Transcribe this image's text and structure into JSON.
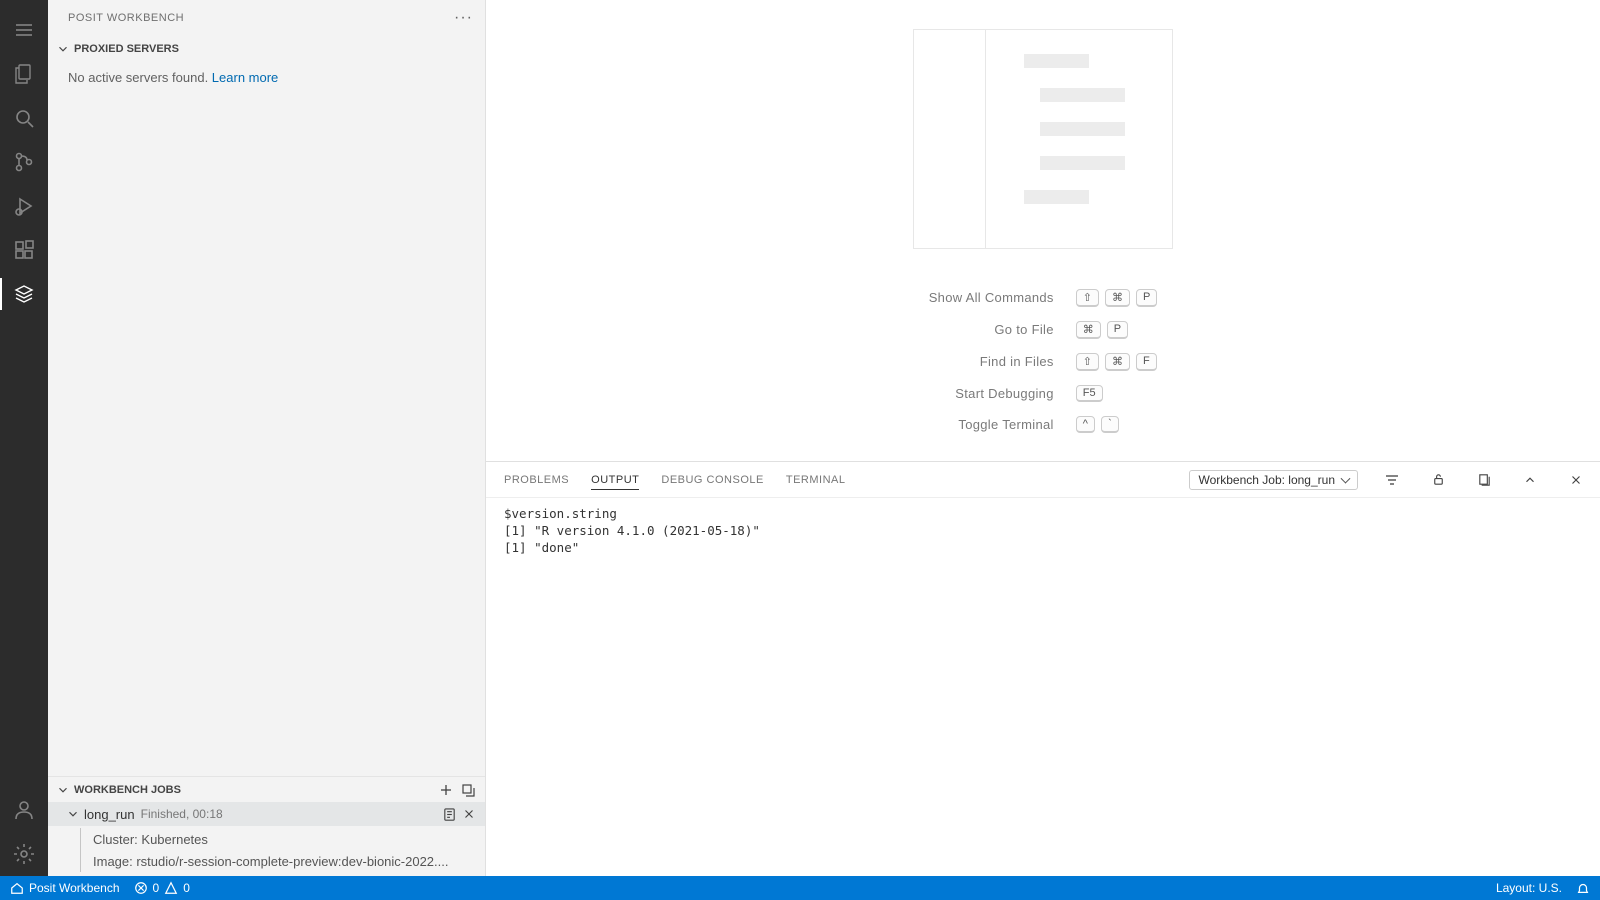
{
  "sidebar": {
    "title": "POSIT WORKBENCH",
    "proxied_section": {
      "title": "PROXIED SERVERS",
      "message": "No active servers found. ",
      "learn_more": "Learn more"
    },
    "jobs_section": {
      "title": "WORKBENCH JOBS",
      "job": {
        "name": "long_run",
        "status": "Finished, 00:18",
        "cluster": "Cluster: Kubernetes",
        "image": "Image: rstudio/r-session-complete-preview:dev-bionic-2022...."
      }
    }
  },
  "welcome": {
    "cmds": [
      {
        "label": "Show All Commands",
        "keys": [
          "⇧",
          "⌘",
          "P"
        ]
      },
      {
        "label": "Go to File",
        "keys": [
          "⌘",
          "P"
        ]
      },
      {
        "label": "Find in Files",
        "keys": [
          "⇧",
          "⌘",
          "F"
        ]
      },
      {
        "label": "Start Debugging",
        "keys": [
          "F5"
        ]
      },
      {
        "label": "Toggle Terminal",
        "keys": [
          "^",
          "`"
        ]
      }
    ]
  },
  "panel": {
    "tabs": [
      "PROBLEMS",
      "OUTPUT",
      "DEBUG CONSOLE",
      "TERMINAL"
    ],
    "active_tab": "OUTPUT",
    "select_label": "Workbench Job: long_run",
    "output": [
      "$version.string",
      "[1] \"R version 4.1.0 (2021-05-18)\"",
      "",
      "[1] \"done\""
    ]
  },
  "statusbar": {
    "left_label": "Posit Workbench",
    "errors": "0",
    "warnings": "0",
    "layout": "Layout: U.S."
  }
}
